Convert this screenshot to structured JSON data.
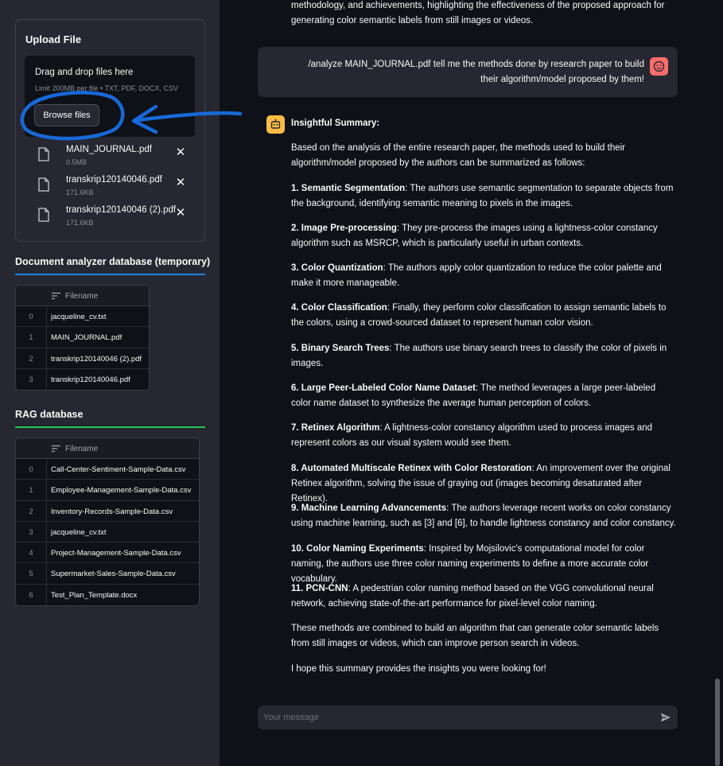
{
  "sidebar": {
    "upload": {
      "title": "Upload File",
      "drop_title": "Drag and drop files here",
      "limit_text": "Limit 200MB per file • TXT, PDF, DOCX, CSV",
      "browse_label": "Browse files",
      "files": [
        {
          "name": "MAIN_JOURNAL.pdf",
          "size": "0.5MB"
        },
        {
          "name": "transkrip120140046.pdf",
          "size": "171.6KB"
        },
        {
          "name": "transkrip120140046 (2).pdf",
          "size": "171.6KB"
        }
      ],
      "remove_glyph": "✕"
    },
    "doc_db": {
      "title": "Document analyzer database (temporary)",
      "rule_color": "#1c83e1",
      "column": "Filename",
      "rows": [
        {
          "idx": "0",
          "value": "jacqueline_cv.txt"
        },
        {
          "idx": "1",
          "value": "MAIN_JOURNAL.pdf"
        },
        {
          "idx": "2",
          "value": "transkrip120140046 (2).pdf"
        },
        {
          "idx": "3",
          "value": "transkrip120140046.pdf"
        }
      ]
    },
    "rag_db": {
      "title": "RAG database",
      "rule_color": "#21c354",
      "column": "Filename",
      "rows": [
        {
          "idx": "0",
          "value": "Call-Center-Sentiment-Sample-Data.csv"
        },
        {
          "idx": "1",
          "value": "Employee-Management-Sample-Data.csv"
        },
        {
          "idx": "2",
          "value": "Inventory-Records-Sample-Data.csv"
        },
        {
          "idx": "3",
          "value": "jacqueline_cv.txt"
        },
        {
          "idx": "4",
          "value": "Project-Management-Sample-Data.csv"
        },
        {
          "idx": "5",
          "value": "Supermarket-Sales-Sample-Data.csv"
        },
        {
          "idx": "6",
          "value": "Test_Plan_Template.docx"
        }
      ]
    }
  },
  "chat": {
    "prev_line1": "methodology, and achievements, highlighting the effectiveness of the proposed approach for",
    "prev_line2": "generating color semantic labels from still images or videos.",
    "user_message": "/analyze MAIN_JOURNAL.pdf tell me the methods done by research paper to build their algorithm/model proposed by them!",
    "assistant": {
      "heading": "Insightful Summary:",
      "intro": "Based on the analysis of the entire research paper, the methods used to build their algorithm/model proposed by the authors can be summarized as follows:",
      "items": [
        {
          "label": "1. Semantic Segmentation",
          "text": ": The authors use semantic segmentation to separate objects from the background, identifying semantic meaning to pixels in the images."
        },
        {
          "label": "2. Image Pre-processing",
          "text": ": They pre-process the images using a lightness-color constancy algorithm such as MSRCP, which is particularly useful in urban contexts."
        },
        {
          "label": "3. Color Quantization",
          "text": ": The authors apply color quantization to reduce the color palette and make it more manageable."
        },
        {
          "label": "4. Color Classification",
          "text": ": Finally, they perform color classification to assign semantic labels to the colors, using a crowd-sourced dataset to represent human color vision."
        },
        {
          "label": "5. Binary Search Trees",
          "text": ": The authors use binary search trees to classify the color of pixels in images."
        },
        {
          "label": "6. Large Peer-Labeled Color Name Dataset",
          "text": ": The method leverages a large peer-labeled color name dataset to synthesize the average human perception of colors."
        },
        {
          "label": "7. Retinex Algorithm",
          "text": ": A lightness-color constancy algorithm used to process images and represent colors as our visual system would see them."
        },
        {
          "label": "8. Automated Multiscale Retinex with Color Restoration",
          "text": ": An improvement over the original Retinex algorithm, solving the issue of graying out (images becoming desaturated after Retinex)."
        },
        {
          "label": "9. Machine Learning Advancements",
          "text": ": The authors leverage recent works on color constancy using machine learning, such as [3] and [6], to handle lightness constancy and color constancy."
        },
        {
          "label": "10. Color Naming Experiments",
          "text": ": Inspired by Mojsilovic's computational model for color naming, the authors use three color naming experiments to define a more accurate color vocabulary."
        },
        {
          "label": "11. PCN-CNN",
          "text": ": A pedestrian color naming method based on the VGG convolutional neural network, achieving state-of-the-art performance for pixel-level color naming."
        }
      ],
      "closing": "These methods are combined to build an algorithm that can generate color semantic labels from still images or videos, which can improve person search in videos.",
      "signoff": "I hope this summary provides the insights you were looking for!"
    },
    "input_placeholder": "Your message"
  },
  "colors": {
    "user_avatar": "#ff6c6c",
    "assistant_avatar": "#ffbd45",
    "annotation": "#1769d8"
  },
  "icons": {
    "file": "file-icon",
    "remove": "close-icon",
    "column": "column-type-icon",
    "send": "send-icon",
    "user_avatar": "user-avatar-icon",
    "bot_avatar": "bot-avatar-icon"
  }
}
